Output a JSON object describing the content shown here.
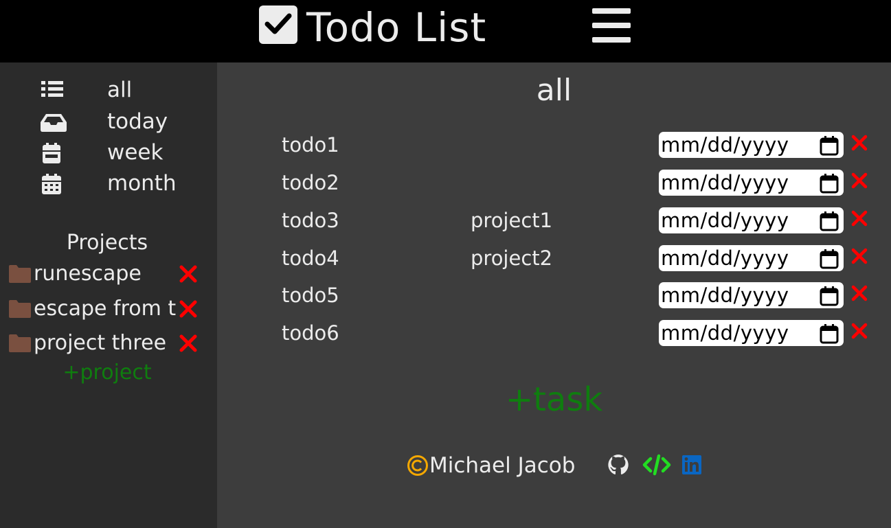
{
  "header": {
    "title": "Todo List",
    "logo_icon": "checkbox-checked-icon",
    "menu_icon": "hamburger-menu-icon"
  },
  "sidebar": {
    "nav": [
      {
        "label": "all",
        "icon": "list-icon"
      },
      {
        "label": "today",
        "icon": "inbox-icon"
      },
      {
        "label": "week",
        "icon": "calendar-week-icon"
      },
      {
        "label": "month",
        "icon": "calendar-month-icon"
      }
    ],
    "projects_heading": "Projects",
    "projects": [
      {
        "label": "runescape",
        "icon": "folder-icon"
      },
      {
        "label": "escape from tarkov",
        "icon": "folder-icon"
      },
      {
        "label": "project three",
        "icon": "folder-icon"
      }
    ],
    "add_project_label": "+project"
  },
  "main": {
    "title": "all",
    "todos": [
      {
        "name": "todo1",
        "project": "",
        "date_placeholder": "mm/dd/yyyy"
      },
      {
        "name": "todo2",
        "project": "",
        "date_placeholder": "mm/dd/yyyy"
      },
      {
        "name": "todo3",
        "project": "project1",
        "date_placeholder": "mm/dd/yyyy"
      },
      {
        "name": "todo4",
        "project": "project2",
        "date_placeholder": "mm/dd/yyyy"
      },
      {
        "name": "todo5",
        "project": "",
        "date_placeholder": "mm/dd/yyyy"
      },
      {
        "name": "todo6",
        "project": "",
        "date_placeholder": "mm/dd/yyyy"
      }
    ],
    "add_task_label": "+task"
  },
  "footer": {
    "author": "Michael Jacob",
    "copyright_icon": "copyright-icon",
    "links": [
      {
        "icon": "github-icon"
      },
      {
        "icon": "code-icon"
      },
      {
        "icon": "linkedin-icon"
      }
    ]
  },
  "colors": {
    "header_bg": "#000000",
    "sidebar_bg": "#2b2b2b",
    "main_bg": "#3d3d3d",
    "text": "#ececec",
    "delete_red": "#ff0000",
    "add_green": "#0f7d0f",
    "folder_brown": "#7a5040",
    "copyright_orange": "#f5a800",
    "code_green": "#22dd22",
    "linkedin_blue": "#0a66c2"
  }
}
